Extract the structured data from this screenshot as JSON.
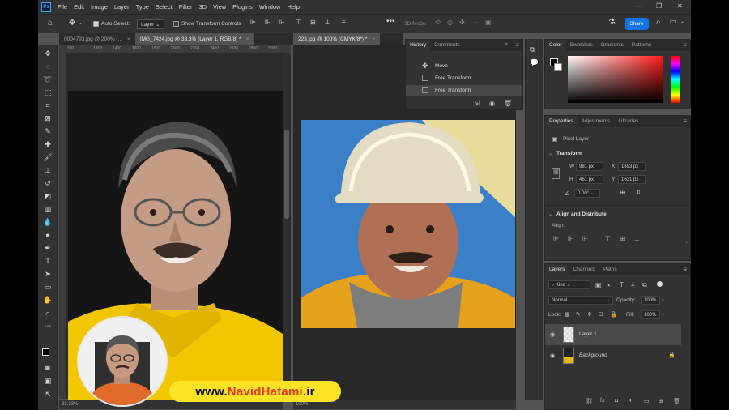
{
  "menubar": {
    "logo": "Ps",
    "items": [
      "File",
      "Edit",
      "Image",
      "Layer",
      "Type",
      "Select",
      "Filter",
      "3D",
      "View",
      "Plugins",
      "Window",
      "Help"
    ]
  },
  "options": {
    "auto_select_label": "Auto-Select:",
    "auto_select_value": "Layer",
    "show_transform_label": "Show Transform Controls",
    "mode_3d": "3D Mode:",
    "share": "Share"
  },
  "tabs": {
    "left": [
      {
        "label": "0004793.jpg @ 200% (...",
        "active": false
      },
      {
        "label": "IMG_7424.jpg @ 33.3% (Layer 1, RGB/8) *",
        "active": true
      }
    ],
    "right": [
      {
        "label": "223.jpg @ 100% (CMYK/8*) *",
        "active": true
      }
    ]
  },
  "ruler": {
    "ticks": [
      "300",
      "1200",
      "1400",
      "1600",
      "1800",
      "2000",
      "2200",
      "2400",
      "2600",
      "2800",
      "3000"
    ]
  },
  "status": {
    "left_zoom": "33.33%",
    "right_zoom": "100%"
  },
  "history": {
    "tabs": [
      "History",
      "Comments"
    ],
    "items": [
      {
        "label": "Move",
        "current": false
      },
      {
        "label": "Free Transform",
        "current": false
      },
      {
        "label": "Free Transform",
        "current": true
      }
    ]
  },
  "color_panel": {
    "tabs": [
      "Color",
      "Swatches",
      "Gradients",
      "Patterns"
    ],
    "hue_color": "#ff2020"
  },
  "properties": {
    "tabs": [
      "Properties",
      "Adjustments",
      "Libraries"
    ],
    "kind": "Pixel Layer",
    "transform_title": "Transform",
    "w": "981 px",
    "h": "461 px",
    "x": "1693 px",
    "y": "1631 px",
    "angle": "0.00°",
    "align_title": "Align and Distribute",
    "align_label": "Align:"
  },
  "layers": {
    "tabs": [
      "Layers",
      "Channels",
      "Paths"
    ],
    "kind_filter": "Kind",
    "blend_mode": "Normal",
    "opacity_label": "Opacity:",
    "opacity": "100%",
    "lock_label": "Lock:",
    "fill_label": "Fill:",
    "fill": "100%",
    "items": [
      {
        "name": "Layer 1",
        "selected": true
      },
      {
        "name": "Background",
        "selected": false
      }
    ]
  },
  "watermark": {
    "prefix": "www.",
    "name_a": "Navid",
    "name_b": "Hatami",
    "suffix": ".ir"
  }
}
